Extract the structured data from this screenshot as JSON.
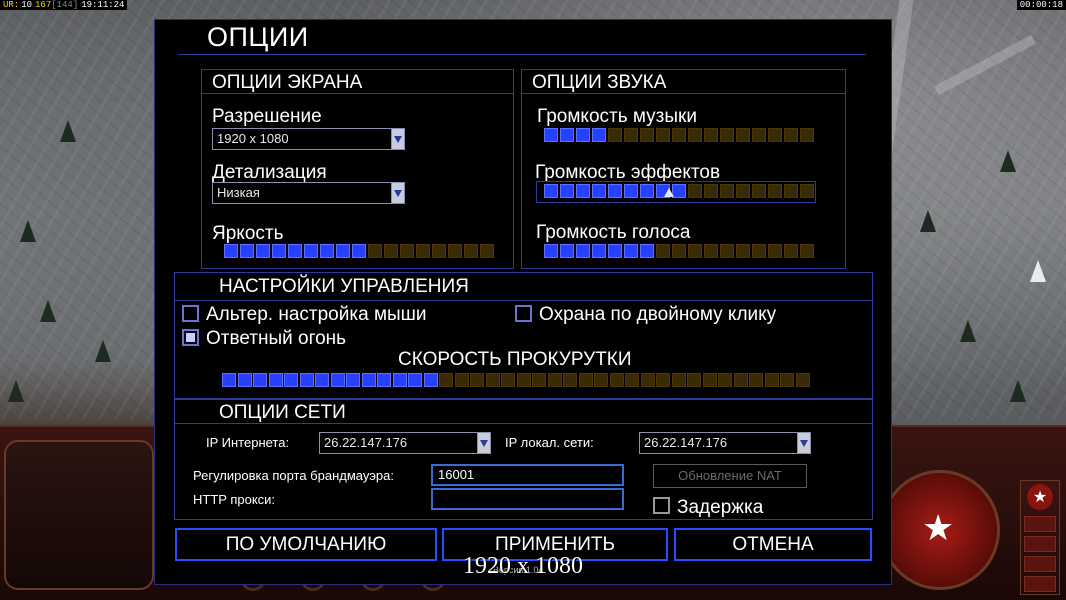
{
  "status_bar": {
    "prefix": "UR:",
    "value": "10",
    "highlight": "167",
    "dim": "[144]",
    "clock": "19:11:24",
    "timer": "00:00:18"
  },
  "title": "ОПЦИИ",
  "display": {
    "header": "ОПЦИИ ЭКРАНА",
    "resolution_label": "Разрешение",
    "resolution_value": "1920 x 1080",
    "detail_label": "Детализация",
    "detail_value": "Низкая",
    "brightness_label": "Яркость",
    "brightness_level": {
      "filled": 9,
      "total": 17
    }
  },
  "sound": {
    "header": "ОПЦИИ ЗВУКА",
    "music_label": "Громкость музыки",
    "music_level": {
      "filled": 4,
      "total": 17
    },
    "effects_label": "Громкость эффектов",
    "effects_level": {
      "filled": 9,
      "total": 17
    },
    "voice_label": "Громкость голоса",
    "voice_level": {
      "filled": 7,
      "total": 17
    }
  },
  "controls": {
    "header": "НАСТРОЙКИ УПРАВЛЕНИЯ",
    "alt_mouse_label": "Альтер. настройка мыши",
    "alt_mouse_checked": false,
    "double_click_label": "Охрана по двойному клику",
    "double_click_checked": false,
    "return_fire_label": "Ответный огонь",
    "return_fire_checked": true,
    "scroll_label": "СКОРОСТЬ ПРОКУРУТКИ",
    "scroll_level": {
      "filled": 14,
      "total": 38
    }
  },
  "network": {
    "header": "ОПЦИИ СЕТИ",
    "internet_ip_label": "IP Интернета:",
    "internet_ip_value": "26.22.147.176",
    "lan_ip_label": "IP локал. сети:",
    "lan_ip_value": "26.22.147.176",
    "firewall_label": "Регулировка порта брандмауэра:",
    "firewall_value": "16001",
    "proxy_label": "HTTP прокси:",
    "proxy_value": "",
    "nat_button": "Обновление NAT",
    "delay_label": "Задержка",
    "delay_checked": false
  },
  "buttons": {
    "defaults": "ПО УМОЛЧАНИЮ",
    "apply": "ПРИМЕНИТЬ",
    "cancel": "ОТМЕНА"
  },
  "version_text": "Версия 1.04",
  "resolution_overlay": "1920 x 1080",
  "colors": {
    "accent_blue": "#2a4cff",
    "slider_on": "#2840ff",
    "slider_off": "#3a2a06",
    "panel_border": "#2c3a98"
  }
}
